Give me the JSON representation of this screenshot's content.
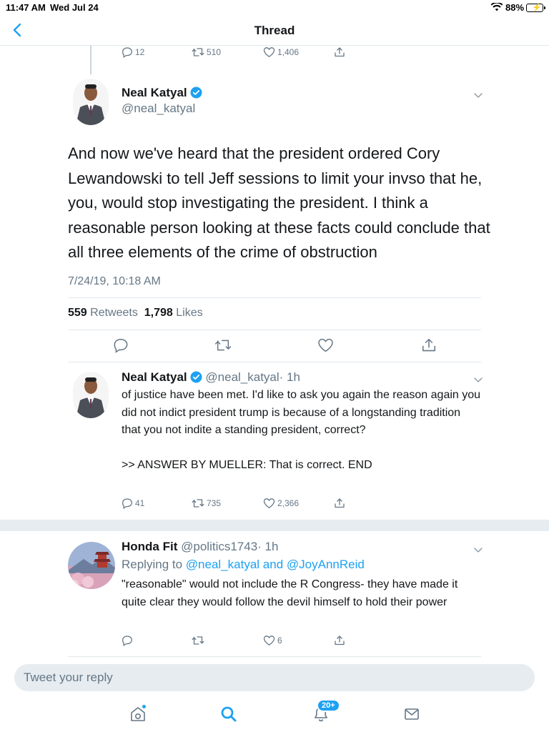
{
  "status_bar": {
    "time": "11:47 AM",
    "date": "Wed Jul 24",
    "battery": "88%"
  },
  "nav": {
    "title": "Thread"
  },
  "prev_tweet_actions": {
    "replies": "12",
    "retweets": "510",
    "likes": "1,406"
  },
  "main_tweet": {
    "name": "Neal Katyal",
    "handle": "@neal_katyal",
    "text": "And now we've heard that the president ordered Cory Lewandowski to tell Jeff sessions to limit your invso that he, you, would stop investigating the president. I think a reasonable person looking at these facts could conclude that all three elements of the crime of obstruction",
    "timestamp": "7/24/19, 10:18 AM",
    "retweets_count": "559",
    "retweets_label": "Retweets",
    "likes_count": "1,798",
    "likes_label": "Likes"
  },
  "reply_1": {
    "name": "Neal Katyal",
    "handle": "@neal_katyal",
    "time": "· 1h",
    "text": "of justice have been met. I'd like to ask you again the reason again you did not indict president trump is because of a longstanding tradition that you not indite a standing president, correct?\n\n>> ANSWER BY MUELLER: That is correct. END",
    "replies": "41",
    "retweets": "735",
    "likes": "2,366"
  },
  "reply_2": {
    "name": "Honda Fit",
    "handle": "@politics1743",
    "time": "· 1h",
    "replying_prefix": "Replying to",
    "replying_user1": "@neal_katyal",
    "replying_and": "and",
    "replying_user2": "@JoyAnnReid",
    "text": "\"reasonable\" would not include the R Congress- they have made it quite clear they would follow the devil himself to hold their power",
    "replies": "",
    "retweets": "",
    "likes": "6"
  },
  "compose": {
    "placeholder": "Tweet your reply"
  },
  "tab_bar": {
    "notifications_badge": "20+"
  },
  "colors": {
    "accent": "#1da1f2",
    "secondary_text": "#657786",
    "divider": "#e1e8ed"
  }
}
